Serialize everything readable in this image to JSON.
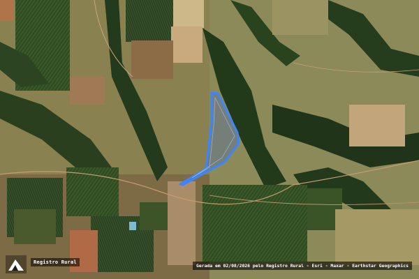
{
  "map": {
    "imagery": "satellite",
    "boundary_color": "#3a86ff",
    "boundary_fill": "#5a6fa0"
  },
  "branding": {
    "label": "Registro Rural",
    "logo_icon": "registro-rural-logo-icon"
  },
  "attribution": "Gerada em 02/08/2026 pelo Registro Rural - Esri - Maxar - Earthstar Geographics"
}
